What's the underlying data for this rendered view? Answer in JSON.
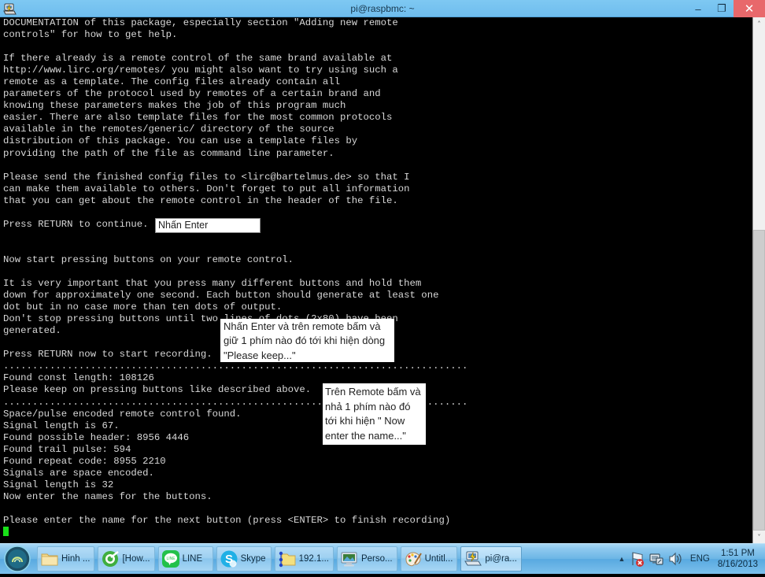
{
  "window": {
    "title": "pi@raspbmc: ~",
    "app_icon": "putty-icon",
    "minimize_label": "–",
    "maximize_label": "❐",
    "close_label": "✕"
  },
  "terminal": {
    "lines": [
      "DOCUMENTATION of this package, especially section \"Adding new remote",
      "controls\" for how to get help.",
      "",
      "If there already is a remote control of the same brand available at",
      "http://www.lirc.org/remotes/ you might also want to try using such a",
      "remote as a template. The config files already contain all",
      "parameters of the protocol used by remotes of a certain brand and",
      "knowing these parameters makes the job of this program much",
      "easier. There are also template files for the most common protocols",
      "available in the remotes/generic/ directory of the source",
      "distribution of this package. You can use a template files by",
      "providing the path of the file as command line parameter.",
      "",
      "Please send the finished config files to <lirc@bartelmus.de> so that I",
      "can make them available to others. Don't forget to put all information",
      "that you can get about the remote control in the header of the file.",
      "",
      "Press RETURN to continue.",
      "",
      "",
      "Now start pressing buttons on your remote control.",
      "",
      "It is very important that you press many different buttons and hold them",
      "down for approximately one second. Each button should generate at least one",
      "dot but in no case more than ten dots of output.",
      "Don't stop pressing buttons until two lines of dots (2x80) have been",
      "generated.",
      "",
      "Press RETURN now to start recording.",
      "................................................................................",
      "Found const length: 108126",
      "Please keep on pressing buttons like described above.",
      "................................................................................",
      "Space/pulse encoded remote control found.",
      "Signal length is 67.",
      "Found possible header: 8956 4446",
      "Found trail pulse: 594",
      "Found repeat code: 8955 2210",
      "Signals are space encoded.",
      "Signal length is 32",
      "Now enter the names for the buttons.",
      "",
      "Please enter the name for the next button (press <ENTER> to finish recording)"
    ],
    "cursor": "block-cursor",
    "cursor_color": "#19e019",
    "background": "#000000",
    "foreground": "#d8d8d8"
  },
  "scrollbar": {
    "up_arrow": "˄",
    "down_arrow": "˅"
  },
  "annotations": [
    {
      "id": "anno-1",
      "text": "Nhấn Enter"
    },
    {
      "id": "anno-2",
      "text": "Nhấn Enter và trên remote bấm và giữ 1 phím nào đó tới khi hiện dòng \"Please keep...\""
    },
    {
      "id": "anno-3",
      "text": "Trên Remote bấm và nhả 1 phím nào đó tới khi hiện \" Now enter the name...\""
    }
  ],
  "taskbar": {
    "start_button": "start-orb",
    "tasks": [
      {
        "label": "Hinh ...",
        "icon": "folder-icon"
      },
      {
        "label": "[How...",
        "icon": "browser-icon"
      },
      {
        "label": "LINE",
        "icon": "line-app-icon"
      },
      {
        "label": "Skype",
        "icon": "skype-icon"
      },
      {
        "label": "192.1...",
        "icon": "network-folder-icon"
      },
      {
        "label": "Perso...",
        "icon": "display-icon"
      },
      {
        "label": "Untitl...",
        "icon": "paint-icon"
      },
      {
        "label": "pi@ra...",
        "icon": "putty-icon",
        "active": true
      }
    ],
    "tray": {
      "expand": "▲",
      "icons": [
        {
          "name": "action-center-flag-icon"
        },
        {
          "name": "network-icon"
        },
        {
          "name": "volume-icon"
        }
      ],
      "language": "ENG",
      "time": "1:51 PM",
      "date": "8/16/2013"
    }
  },
  "colors": {
    "titlebar": "#74c2f0",
    "close_button": "#e8686b",
    "taskbar": "#6bb5e5",
    "terminal_bg": "#000000",
    "cursor_green": "#19e019"
  }
}
